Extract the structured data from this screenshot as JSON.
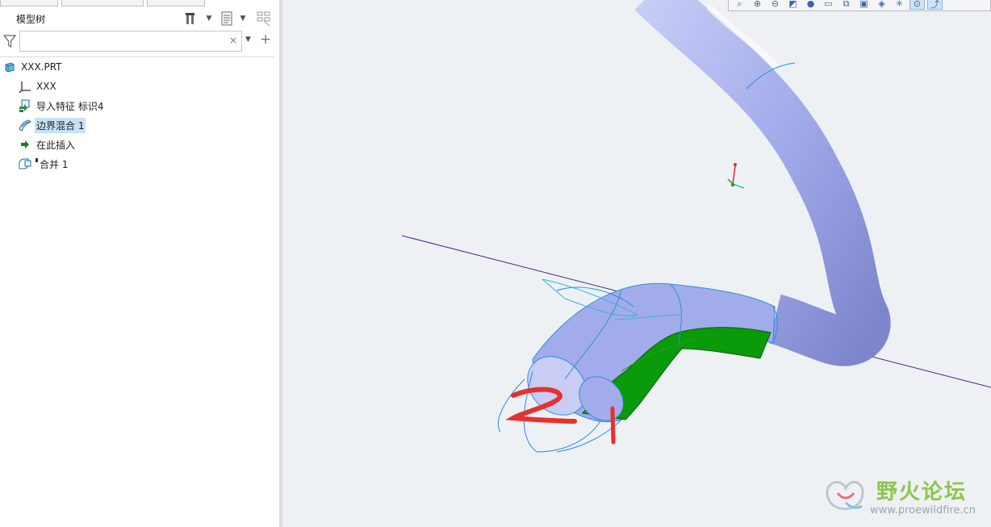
{
  "panel": {
    "title": "模型树",
    "search": {
      "value": "",
      "placeholder": ""
    },
    "clear_glyph": "×",
    "add_glyph": "+",
    "tree": [
      {
        "label": "XXX.PRT",
        "icon": "part-icon"
      },
      {
        "label": "XXX",
        "icon": "coordinate-system-icon"
      },
      {
        "label": "导入特征 标识4",
        "icon": "import-feature-icon"
      },
      {
        "label": "边界混合 1",
        "icon": "boundary-blend-icon",
        "selected": true
      },
      {
        "label": "在此插入",
        "icon": "insert-here-arrow-icon"
      },
      {
        "label": "合并 1",
        "icon": "merge-icon"
      }
    ]
  },
  "graphics": {
    "toolbar_icons": [
      "refit-icon",
      "zoom-in-icon",
      "zoom-out-icon",
      "repaint-icon",
      "display-style-icon",
      "saved-views-icon",
      "view-manager-icon",
      "perspective-icon",
      "annotation-icon",
      "datum-display-icon",
      "spin-center-icon",
      "tool-icon"
    ],
    "annotation_1": "1",
    "annotation_2": "2",
    "surface_color": "#a3aceb",
    "green_surface_color": "#0a9a0a",
    "edge_color": "#2a8fe0",
    "axis_color": "#3b2a7a",
    "annotation_color": "#e8302e"
  },
  "watermark": {
    "title": "野火论坛",
    "url": "www.proewildfire.cn"
  }
}
